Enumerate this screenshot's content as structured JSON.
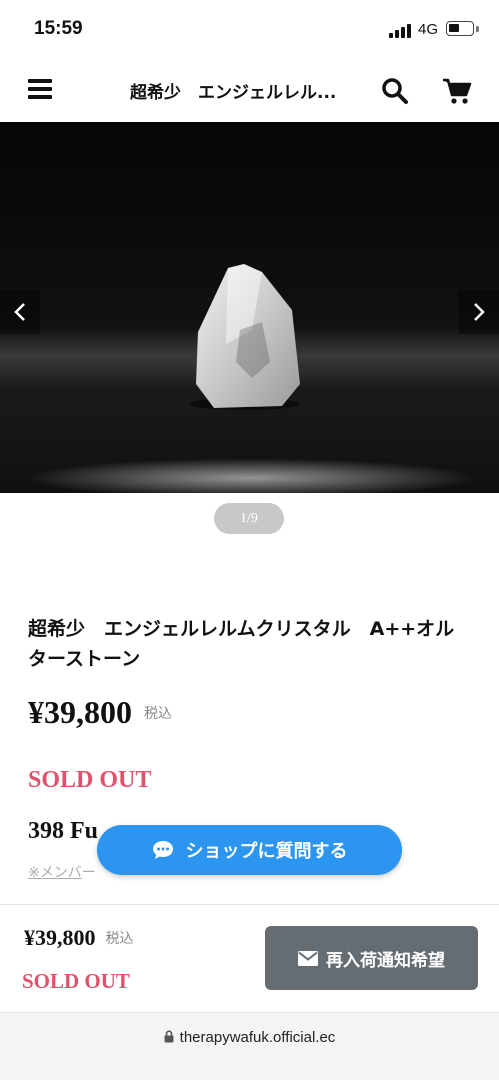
{
  "status_bar": {
    "time": "15:59",
    "network": "4G"
  },
  "header": {
    "title": "超希少　エンジェルレル..."
  },
  "gallery": {
    "counter": "1/9"
  },
  "product": {
    "title": "超希少　エンジェルレルムクリスタル　A++オルタ⁠ーストーン",
    "price": "¥39,800",
    "tax_label": "税込",
    "status": "SOLD OUT",
    "points": "398 Fu",
    "member_note_link": "※メンバ",
    "member_note_rest": "ー"
  },
  "ask_button": {
    "label": "ショップに質問する"
  },
  "bottom_bar": {
    "price": "¥39,800",
    "tax_label": "税込",
    "status": "SOLD OUT",
    "notify_label": "再入荷通知希望"
  },
  "browser": {
    "url": "therapywafuk.official.ec"
  },
  "colors": {
    "accent_blue": "#2b95f0",
    "sold_out_pink": "#e0516c",
    "notify_gray": "#656d73"
  }
}
